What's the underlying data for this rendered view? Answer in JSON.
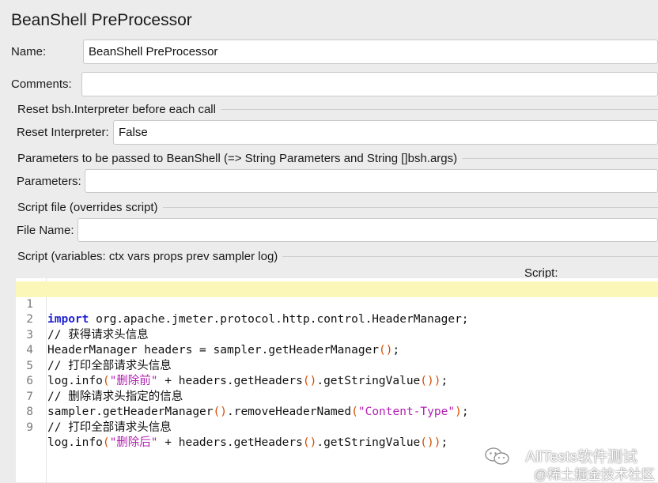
{
  "panel": {
    "title": "BeanShell PreProcessor"
  },
  "name": {
    "label": "Name:",
    "value": "BeanShell PreProcessor"
  },
  "comments": {
    "label": "Comments:",
    "value": ""
  },
  "reset": {
    "section_title": "Reset bsh.Interpreter before each call",
    "label": "Reset Interpreter:",
    "value": "False"
  },
  "parameters": {
    "section_title": "Parameters to be passed to BeanShell (=> String Parameters and String []bsh.args)",
    "label": "Parameters:",
    "value": ""
  },
  "script_file": {
    "section_title": "Script file (overrides script)",
    "label": "File Name:",
    "value": ""
  },
  "script": {
    "section_title": "Script (variables: ctx vars props prev sampler log)",
    "label": "Script:",
    "lines": [
      {
        "num": "1",
        "text": "import org.apache.jmeter.protocol.http.control.HeaderManager;"
      },
      {
        "num": "2",
        "text": "// 获得请求头信息"
      },
      {
        "num": "3",
        "text": "HeaderManager headers = sampler.getHeaderManager();"
      },
      {
        "num": "4",
        "text": "// 打印全部请求头信息"
      },
      {
        "num": "5",
        "text": "log.info(\"删除前\" + headers.getHeaders().getStringValue());"
      },
      {
        "num": "6",
        "text": "// 删除请求头指定的信息"
      },
      {
        "num": "7",
        "text": "sampler.getHeaderManager().removeHeaderNamed(\"Content-Type\");"
      },
      {
        "num": "8",
        "text": "// 打印全部请求头信息"
      },
      {
        "num": "9",
        "text": "log.info(\"删除后\" + headers.getHeaders().getStringValue());"
      }
    ]
  },
  "watermark": {
    "line1": "AllTests软件测试",
    "line2": "@稀土掘金技术社区",
    "icon": "wechat-icon"
  },
  "colors": {
    "keyword": "#1f1fd6",
    "comment": "#1a9a1a",
    "string": "#b21fb2",
    "paren": "#d44d00",
    "current_line": "#fbf7b9"
  }
}
